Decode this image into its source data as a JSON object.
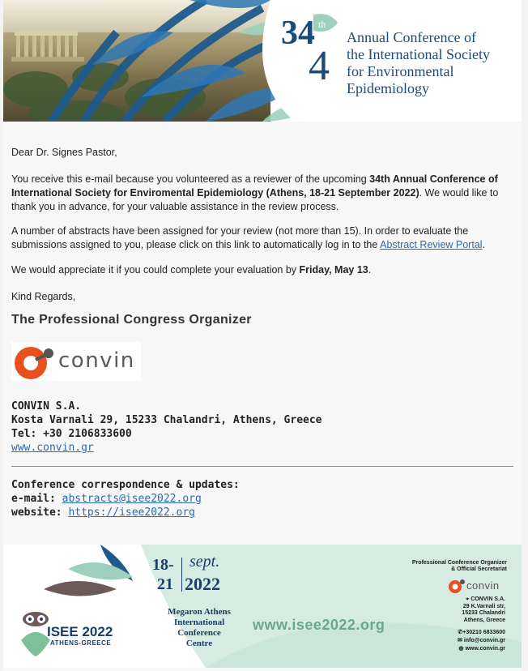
{
  "header": {
    "conference_number": "34",
    "conference_ordinal": "th",
    "title_lines": [
      "Annual Conference of",
      "the International Society",
      "for Environmental",
      "Epidemiology"
    ]
  },
  "email": {
    "greeting": "Dear Dr. Signes Pastor,",
    "intro_prefix": "You receive this e-mail because you volunteered as a reviewer of the upcoming ",
    "intro_bold": "34th Annual Conference of International Society for Enviromental Epidemiology (Athens, 18-21 September 2022)",
    "intro_suffix": ". We would like to thank you in advance, for your valuable assistance in the review process.",
    "abstracts_prefix": "A number of abstracts have been assigned for your review (not more than 15). In order to evaluate the submissions assigned to you, please click on this link to automatically log in to the ",
    "abstracts_link": "Abstract Review Portal",
    "abstracts_suffix": ".",
    "appreciate_prefix": "We would appreciate it if you could complete your evaluation by ",
    "appreciate_bold": "Friday, May 13",
    "appreciate_suffix": ".",
    "regards": "Kind Regards,",
    "organizer_title": "The Professional Congress Organizer"
  },
  "convin_logo": {
    "word": "convin"
  },
  "contact": {
    "company": "CONVIN S.A.",
    "address": "Kosta Varnali 29, 15233 Chalandri, Athens, Greece",
    "tel": "Tel: +30 2106833600",
    "website": "www.convin.gr"
  },
  "correspondence": {
    "heading": "Conference correspondence & updates:",
    "email_label": "e-mail:",
    "email_value": "abstracts@isee2022.org",
    "website_label": "website:",
    "website_value": "https://isee2022.org"
  },
  "footer": {
    "day_start": "18-",
    "month": "sept.",
    "day_end": "21",
    "year": "2022",
    "venue_lines": [
      "Megaron Athens",
      "International",
      "Conference",
      "Centre"
    ],
    "url": "www.isee2022.org",
    "isee_name": "ISEE 2022",
    "isee_location": "ATHENS-GREECE",
    "pco_line1": "Professional Conference Organizer",
    "pco_line2": "& Official Secretariat",
    "convin_word": "convin",
    "address_lines": [
      "CONVIN S.A.",
      "29 K.Varnali str,",
      "15233 Chalandri",
      "Athens, Greece"
    ],
    "phone": "+30210 6833600",
    "email": "info@convin.gr",
    "web": "www.convin.gr"
  },
  "colors": {
    "navy": "#1b4b7a",
    "link": "#2a6bb0",
    "convin_orange": "#e8501e",
    "mint": "#d6ebe1",
    "green_text": "#6aa88e"
  }
}
